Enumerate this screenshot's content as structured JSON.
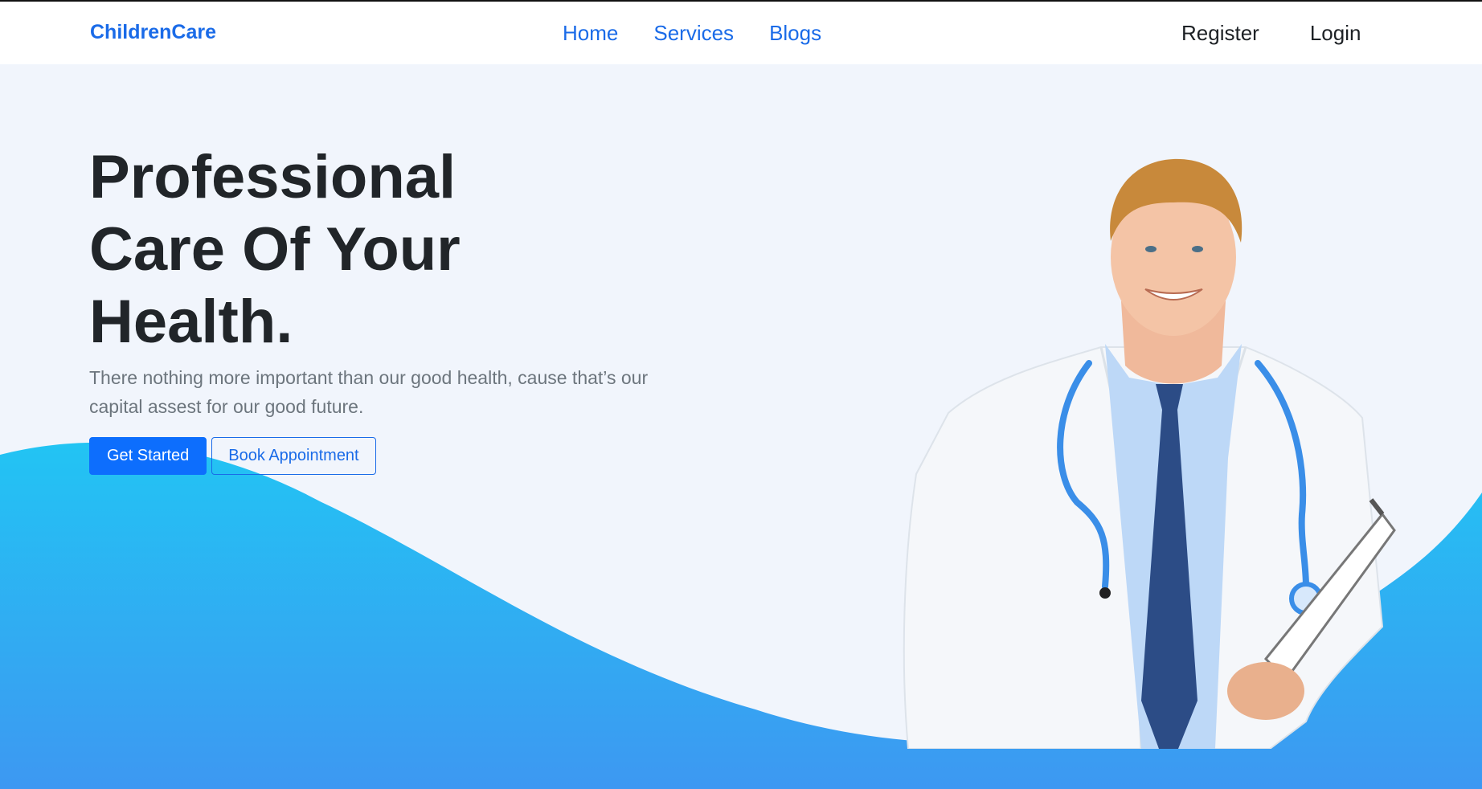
{
  "nav": {
    "brand": "ChildrenCare",
    "links": [
      "Home",
      "Services",
      "Blogs"
    ],
    "register": "Register",
    "login": "Login"
  },
  "hero": {
    "title_lines": [
      "Professional",
      "Care Of Your",
      "Health."
    ],
    "description": "There nothing more important than our good health, cause that’s our capital assest for our good future.",
    "get_started": "Get Started",
    "book_appointment": "Book Appointment",
    "image": "doctor-photo"
  },
  "colors": {
    "brand": "#1a6be8",
    "primary_button": "#0d6efd",
    "hero_background": "#f1f5fc",
    "wave_top": "#22c4f3",
    "wave_bottom": "#3d98f2",
    "heading": "#212529",
    "muted_text": "#6c757d"
  }
}
